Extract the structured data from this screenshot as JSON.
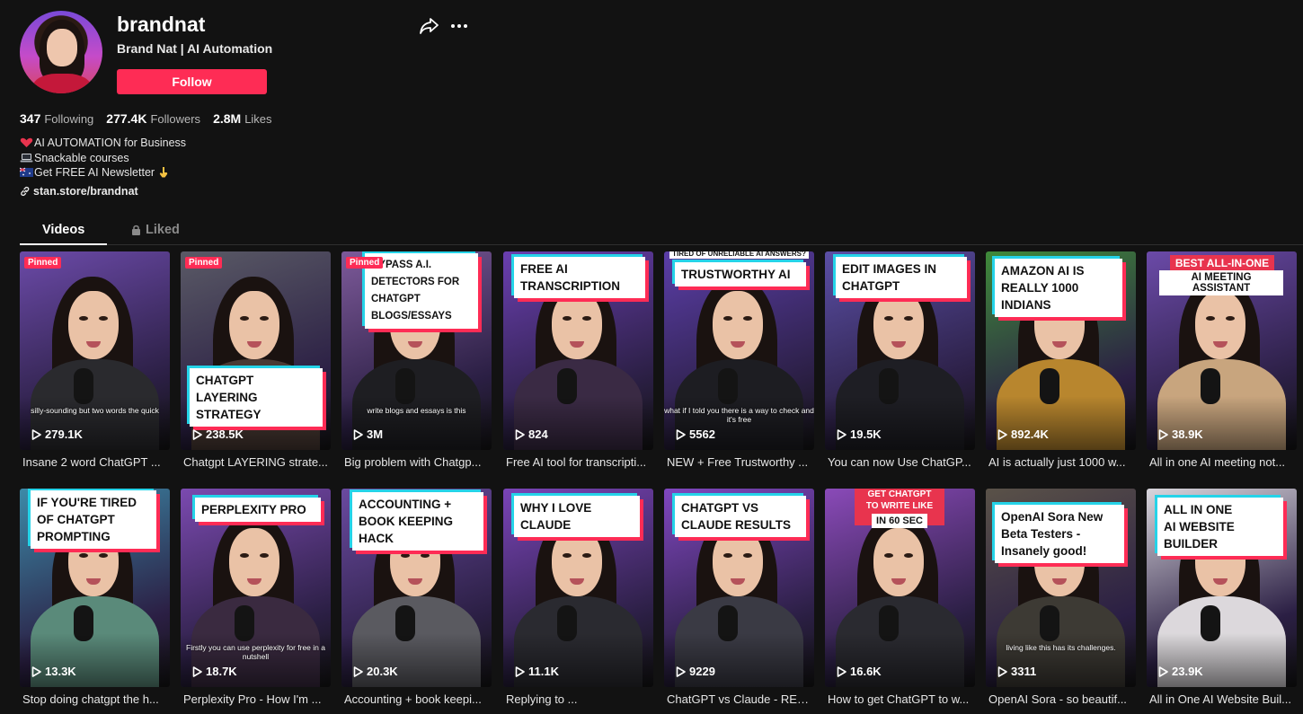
{
  "profile": {
    "username": "brandnat",
    "nickname": "Brand Nat | AI Automation",
    "follow_label": "Follow",
    "stats": {
      "following_count": "347",
      "following_label": "Following",
      "followers_count": "277.4K",
      "followers_label": "Followers",
      "likes_count": "2.8M",
      "likes_label": "Likes"
    },
    "bio": {
      "line1": "AI AUTOMATION for Business",
      "line2": "Snackable courses",
      "line3": "Get FREE AI Newsletter"
    },
    "link": "stan.store/brandnat"
  },
  "tabs": {
    "videos": "Videos",
    "liked": "Liked"
  },
  "pinned_label": "Pinned",
  "videos": [
    {
      "views": "279.1K",
      "title": "Insane 2 word ChatGPT ...",
      "pinned": true,
      "caption": "",
      "subtitle": "silly-sounding but two words the quick",
      "bg": "#6b4aa8"
    },
    {
      "views": "238.5K",
      "title": "Chatgpt LAYERING strate...",
      "pinned": true,
      "caption": "CHATGPT\nLAYERING\nSTRATEGY",
      "subtitle": "",
      "bg": "#5a5a66"
    },
    {
      "views": "3M",
      "title": "Big problem with Chatgp...",
      "pinned": true,
      "caption": "BYPASS A.I.\nDETECTORS FOR\nCHATGPT\nBLOGS/ESSAYS",
      "subtitle": "write blogs and essays is this",
      "bg": "#7d5a9a"
    },
    {
      "views": "824",
      "title": "Free AI tool for transcripti...",
      "pinned": false,
      "caption": "FREE AI\nTRANSCRIPTION",
      "subtitle": "",
      "bg": "#6a3fb0"
    },
    {
      "views": "5562",
      "title": "NEW + Free Trustworthy ...",
      "pinned": false,
      "caption": "TRUSTWORTHY AI",
      "topline": "TIRED OF UNRELIABLE AI ANSWERS?",
      "subtitle": "what if I told you there is a way to check and it's free",
      "bg": "#5b3ea8"
    },
    {
      "views": "19.5K",
      "title": "You can now Use ChatGP...",
      "pinned": false,
      "caption": "EDIT IMAGES IN\nCHATGPT",
      "subtitle": "",
      "bg": "#5b4fa6"
    },
    {
      "views": "892.4K",
      "title": "AI is actually just 1000 w...",
      "pinned": false,
      "caption": "AMAZON AI IS\nREALLY 1000\nINDIANS",
      "subtitle": "",
      "bg": "#3f8a3a"
    },
    {
      "views": "38.9K",
      "title": "All in one AI meeting not...",
      "pinned": false,
      "caption": "",
      "red_top": "BEST ALL-IN-ONE",
      "white_top": "AI MEETING ASSISTANT",
      "subtitle": "",
      "bg": "#6b4aa8"
    },
    {
      "views": "13.3K",
      "title": "Stop doing chatgpt the h...",
      "pinned": false,
      "caption": "IF YOU'RE TIRED\nOF CHATGPT\nPROMPTING",
      "subtitle": "",
      "bg": "#3c8aa8"
    },
    {
      "views": "18.7K",
      "title": "Perplexity Pro - How I'm ...",
      "pinned": false,
      "caption": "PERPLEXITY PRO",
      "subtitle": "Firstly you can use perplexity for free in a nutshell",
      "bg": "#7b4ab0"
    },
    {
      "views": "20.3K",
      "title": "Accounting + book keepi...",
      "pinned": false,
      "caption": "ACCOUNTING +\nBOOK KEEPING\nHACK",
      "subtitle": "",
      "bg": "#6a4aa0"
    },
    {
      "views": "11.1K",
      "title": "Replying to ...",
      "pinned": false,
      "caption": "WHY I LOVE\nCLAUDE",
      "subtitle": "",
      "bg": "#7a44b8"
    },
    {
      "views": "9229",
      "title": "ChatGPT vs Claude - RES...",
      "pinned": false,
      "caption": "CHATGPT VS\nCLAUDE RESULTS",
      "subtitle": "",
      "bg": "#8047c0"
    },
    {
      "views": "16.6K",
      "title": "How to get ChatGPT to w...",
      "pinned": false,
      "caption": "",
      "red_top": "GET CHATGPT\nTO WRITE LIKE YOU",
      "white_top": "IN 60 SEC",
      "subtitle": "",
      "bg": "#8a4ab8"
    },
    {
      "views": "3311",
      "title": "OpenAI Sora - so beautif...",
      "pinned": false,
      "caption": "OpenAI Sora New\nBeta Testers -\nInsanely good!",
      "subtitle": "living like this has its challenges.",
      "bg": "#5a5248"
    },
    {
      "views": "23.9K",
      "title": "All in One AI Website Buil...",
      "pinned": false,
      "caption": "ALL IN ONE\nAI WEBSITE\nBUILDER",
      "subtitle": "",
      "bg": "#d9d6dc"
    }
  ],
  "colors": {
    "accent": "#fe2c55",
    "cyan": "#25d3e8",
    "background": "#121212"
  }
}
